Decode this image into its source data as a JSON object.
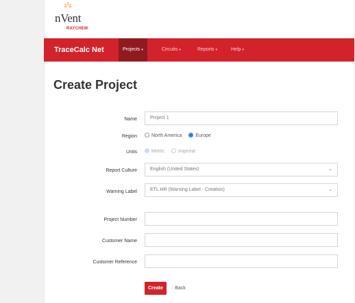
{
  "brand": {
    "logo_text": "nVent",
    "logo_sub": "RAYCHEM",
    "logo_color": "#d2232a"
  },
  "navbar": {
    "title": "TraceCalc Net",
    "background": "#d2232a",
    "items": [
      {
        "label": "Projects",
        "active": true
      },
      {
        "label": "Circuits",
        "active": false
      },
      {
        "label": "Reports",
        "active": false
      },
      {
        "label": "Help",
        "active": false
      }
    ]
  },
  "page": {
    "title": "Create Project"
  },
  "form": {
    "name": {
      "label": "Name",
      "value": "Project 1"
    },
    "region": {
      "label": "Region",
      "options": [
        "North America",
        "Europe"
      ],
      "selected": "Europe"
    },
    "units": {
      "label": "Units",
      "options": [
        "Metric",
        "Imperial"
      ],
      "selected": "Metric",
      "disabled": true
    },
    "report_culture": {
      "label": "Report Culture",
      "value": "English (United States)"
    },
    "warning_label": {
      "label": "Warning Label",
      "value": "ETL HR (Warning Label - Creation)"
    },
    "project_number": {
      "label": "Project Number",
      "value": ""
    },
    "customer_name": {
      "label": "Customer Name",
      "value": ""
    },
    "customer_reference": {
      "label": "Customer Reference",
      "value": ""
    }
  },
  "actions": {
    "create_label": "Create",
    "back_label": "Back"
  }
}
